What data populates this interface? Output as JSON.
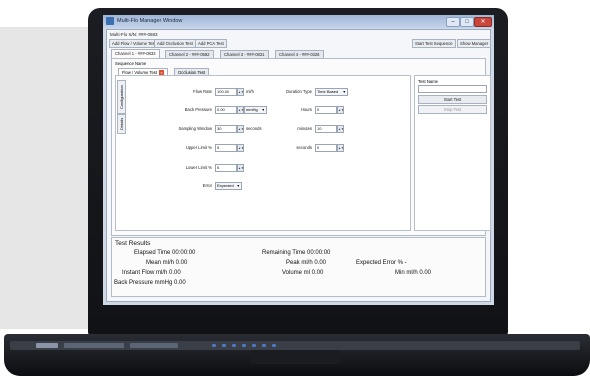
{
  "window": {
    "title": "Multi-Flo Manager Window",
    "buttons": {
      "minimize": "–",
      "maximize": "□",
      "close": "✕"
    }
  },
  "header": {
    "serial_label": "Multi-Flo S/N: ###-0683"
  },
  "toolbar": {
    "left_buttons": [
      "Add Flow / Volume Test",
      "Add Occlusion Test",
      "Add PCA Test"
    ],
    "right_buttons": [
      "Start Test Sequence",
      "Show Manager"
    ]
  },
  "channel_tabs": [
    "Channel 1 - ###-0833",
    "Channel 2 - ###-0582",
    "Channel 3 - ###-0831",
    "Channel 4 - ###-0326"
  ],
  "sequence": {
    "label": "Sequence Name",
    "tabs": [
      "Flow / Volume Test",
      "Occlusion Test"
    ]
  },
  "side_tabs": [
    "Configuration",
    "Details"
  ],
  "form": {
    "flow_rate": {
      "label": "Flow Rate",
      "value": "100.00",
      "unit": "ml/h"
    },
    "back_pressure": {
      "label": "Back Pressure",
      "value": "0.00",
      "unit": "mmHg"
    },
    "sampling_window": {
      "label": "Sampling Window",
      "value": "30",
      "unit": "seconds"
    },
    "upper_limit": {
      "label": "Upper Limit %",
      "value": "5"
    },
    "lower_limit": {
      "label": "Lower Limit %",
      "value": "5"
    },
    "error": {
      "label": "Error",
      "value": "Expected"
    },
    "duration_type": {
      "label": "Duration Type",
      "value": "Time Based"
    },
    "hours": {
      "label": "Hours",
      "value": "0"
    },
    "minutes": {
      "label": "minutes",
      "value": "10"
    },
    "seconds": {
      "label": "seconds",
      "value": "0"
    }
  },
  "test_panel": {
    "test_name_label": "Test Name",
    "start_button": "Start Test",
    "stop_button": "Stop Test"
  },
  "results": {
    "title": "Test Results",
    "elapsed": "Elapsed Time 00:00:00",
    "remaining": "Remaining Time 00:00:00",
    "mean": "Mean ml/h 0.00",
    "peak": "Peak ml/h 0.00",
    "expected_error": "Expected Error % -",
    "instant_flow": "Instant Flow ml/h 0.00",
    "volume": "Volume ml 0.00",
    "min": "Min ml/h 0.00",
    "back_pressure": "Back Pressure mmHg 0.00"
  }
}
